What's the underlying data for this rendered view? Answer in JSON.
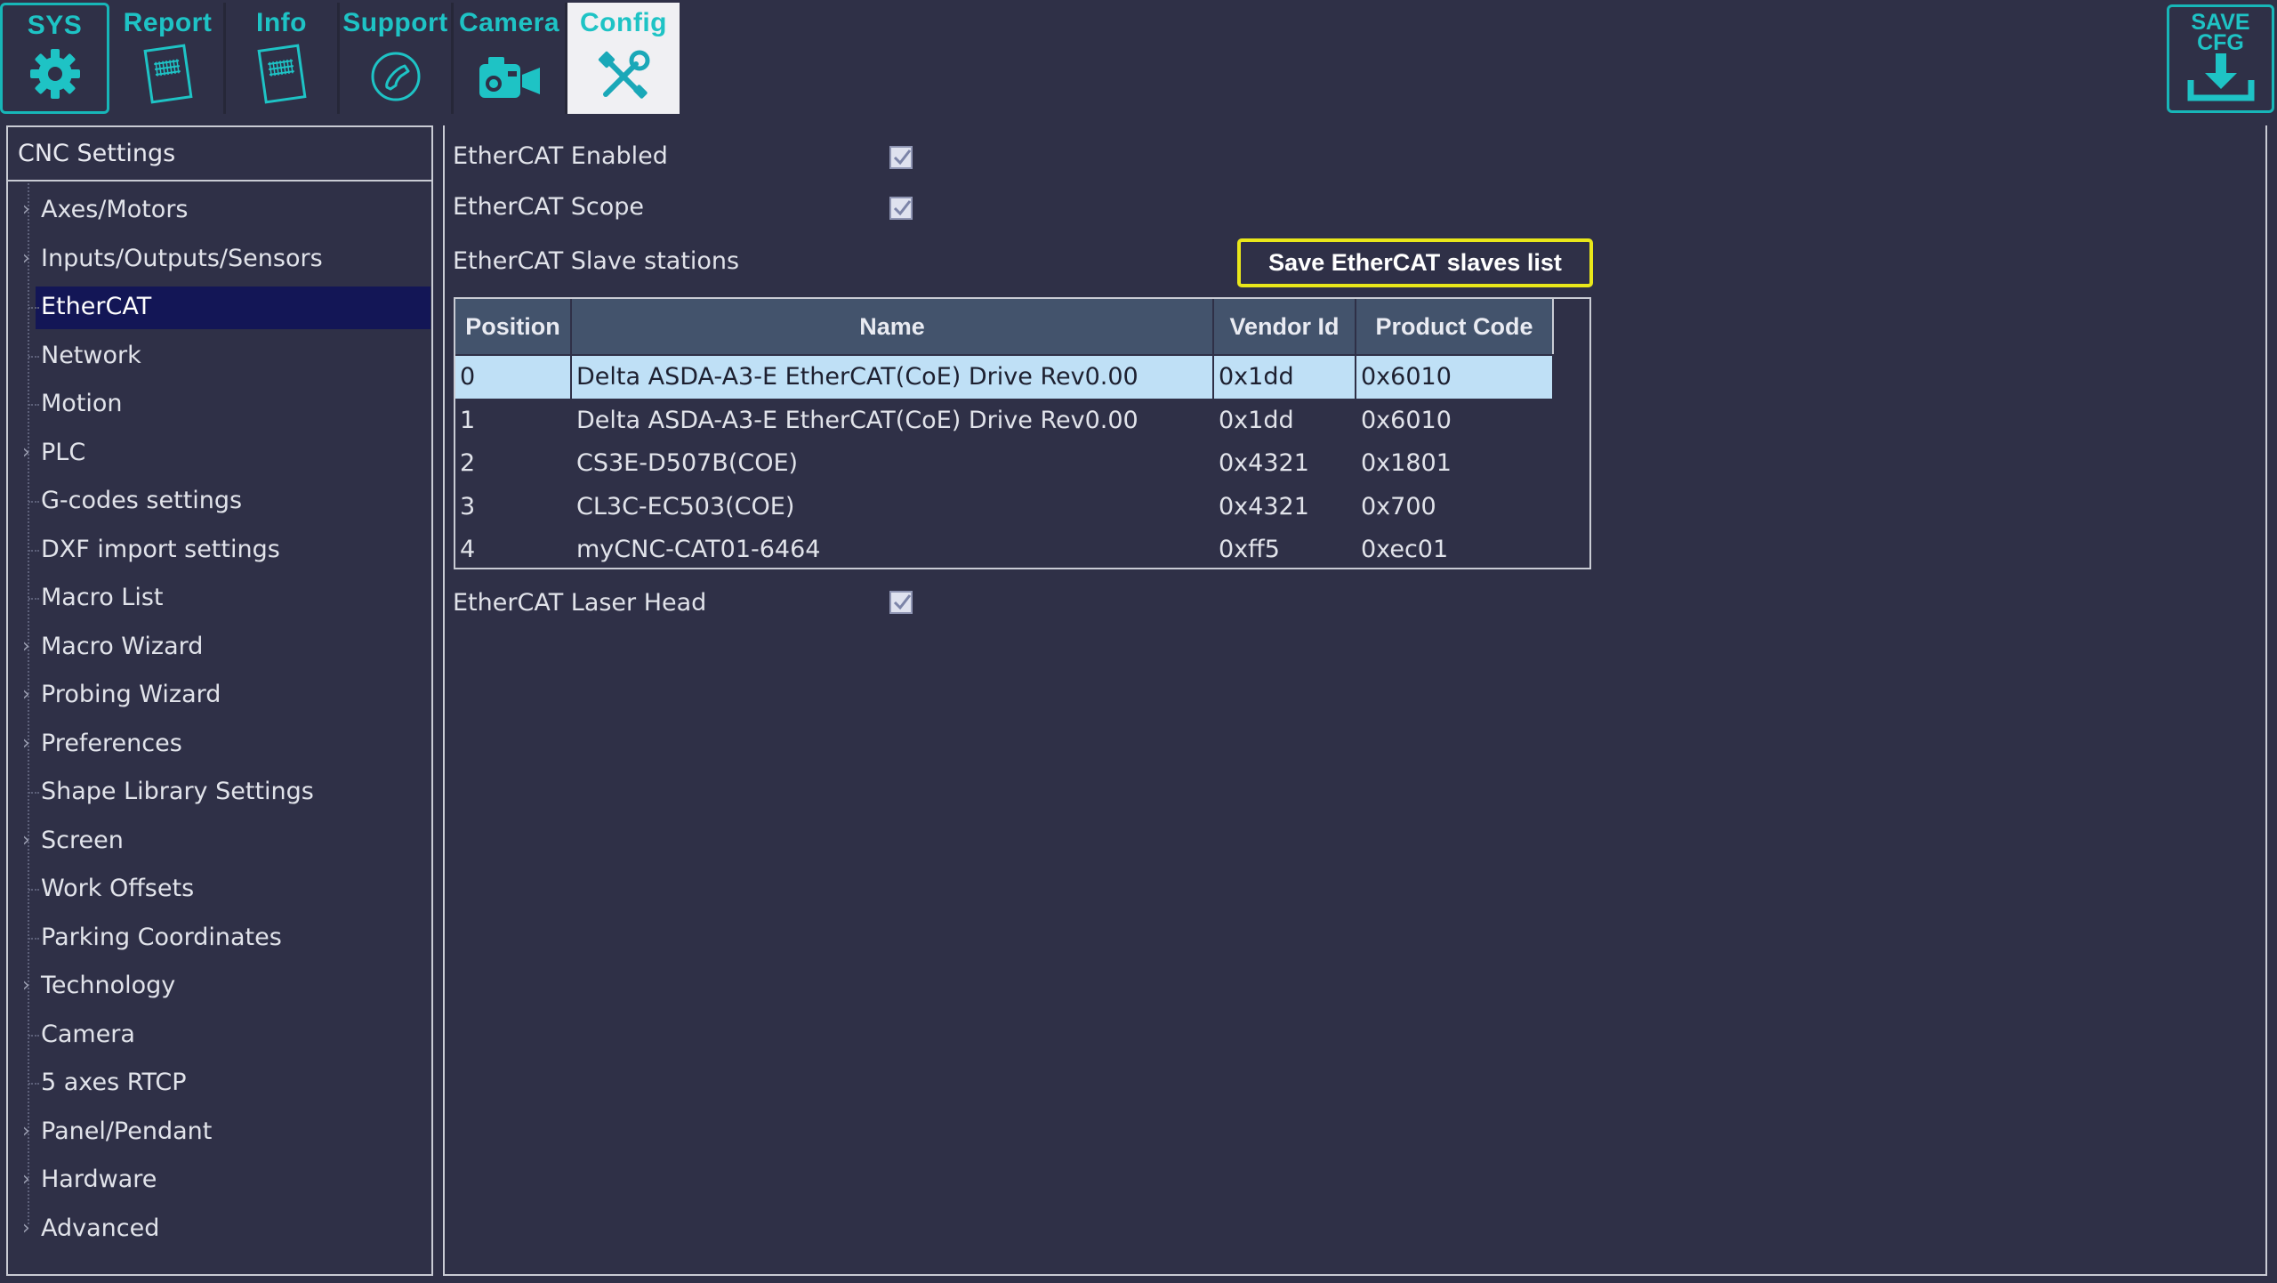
{
  "toolbar": {
    "tabs": [
      {
        "label": "SYS",
        "icon": "gear-icon"
      },
      {
        "label": "Report",
        "icon": "report-icon"
      },
      {
        "label": "Info",
        "icon": "info-document-icon"
      },
      {
        "label": "Support",
        "icon": "phone-icon"
      },
      {
        "label": "Camera",
        "icon": "camera-icon"
      },
      {
        "label": "Config",
        "icon": "tools-icon",
        "active": true
      }
    ],
    "save_cfg": {
      "line1": "SAVE",
      "line2": "CFG",
      "icon": "download-icon"
    },
    "accent_color": "#1ec3c5"
  },
  "sidebar": {
    "header": "CNC Settings",
    "items": [
      {
        "label": "Axes/Motors",
        "expandable": true
      },
      {
        "label": "Inputs/Outputs/Sensors",
        "expandable": true
      },
      {
        "label": "EtherCAT",
        "expandable": false,
        "selected": true
      },
      {
        "label": "Network",
        "expandable": false
      },
      {
        "label": "Motion",
        "expandable": false
      },
      {
        "label": "PLC",
        "expandable": true
      },
      {
        "label": "G-codes settings",
        "expandable": false
      },
      {
        "label": "DXF import settings",
        "expandable": false
      },
      {
        "label": "Macro List",
        "expandable": false
      },
      {
        "label": "Macro Wizard",
        "expandable": true
      },
      {
        "label": "Probing Wizard",
        "expandable": true
      },
      {
        "label": "Preferences",
        "expandable": true
      },
      {
        "label": "Shape Library Settings",
        "expandable": false
      },
      {
        "label": "Screen",
        "expandable": true
      },
      {
        "label": "Work Offsets",
        "expandable": false
      },
      {
        "label": "Parking Coordinates",
        "expandable": false
      },
      {
        "label": "Technology",
        "expandable": true
      },
      {
        "label": "Camera",
        "expandable": false
      },
      {
        "label": "5 axes RTCP",
        "expandable": false
      },
      {
        "label": "Panel/Pendant",
        "expandable": true
      },
      {
        "label": "Hardware",
        "expandable": true
      },
      {
        "label": "Advanced",
        "expandable": true
      }
    ]
  },
  "main": {
    "ethercat_enabled": {
      "label": "EtherCAT Enabled",
      "checked": true
    },
    "ethercat_scope": {
      "label": "EtherCAT Scope",
      "checked": true
    },
    "slave_stations_label": "EtherCAT Slave stations",
    "save_slaves_button": "Save EtherCAT slaves list",
    "table": {
      "columns": [
        "Position",
        "Name",
        "Vendor Id",
        "Product Code"
      ],
      "rows": [
        [
          "0",
          "Delta ASDA-A3-E EtherCAT(CoE) Drive Rev0.00",
          "0x1dd",
          "0x6010"
        ],
        [
          "1",
          "Delta ASDA-A3-E EtherCAT(CoE) Drive Rev0.00",
          "0x1dd",
          "0x6010"
        ],
        [
          "2",
          "CS3E-D507B(COE)",
          "0x4321",
          "0x1801"
        ],
        [
          "3",
          "CL3C-EC503(COE)",
          "0x4321",
          "0x700"
        ],
        [
          "4",
          "myCNC-CAT01-6464",
          "0xff5",
          "0xec01"
        ]
      ],
      "selected_row": 0
    },
    "ethercat_laser_head": {
      "label": "EtherCAT Laser Head",
      "checked": true
    }
  }
}
